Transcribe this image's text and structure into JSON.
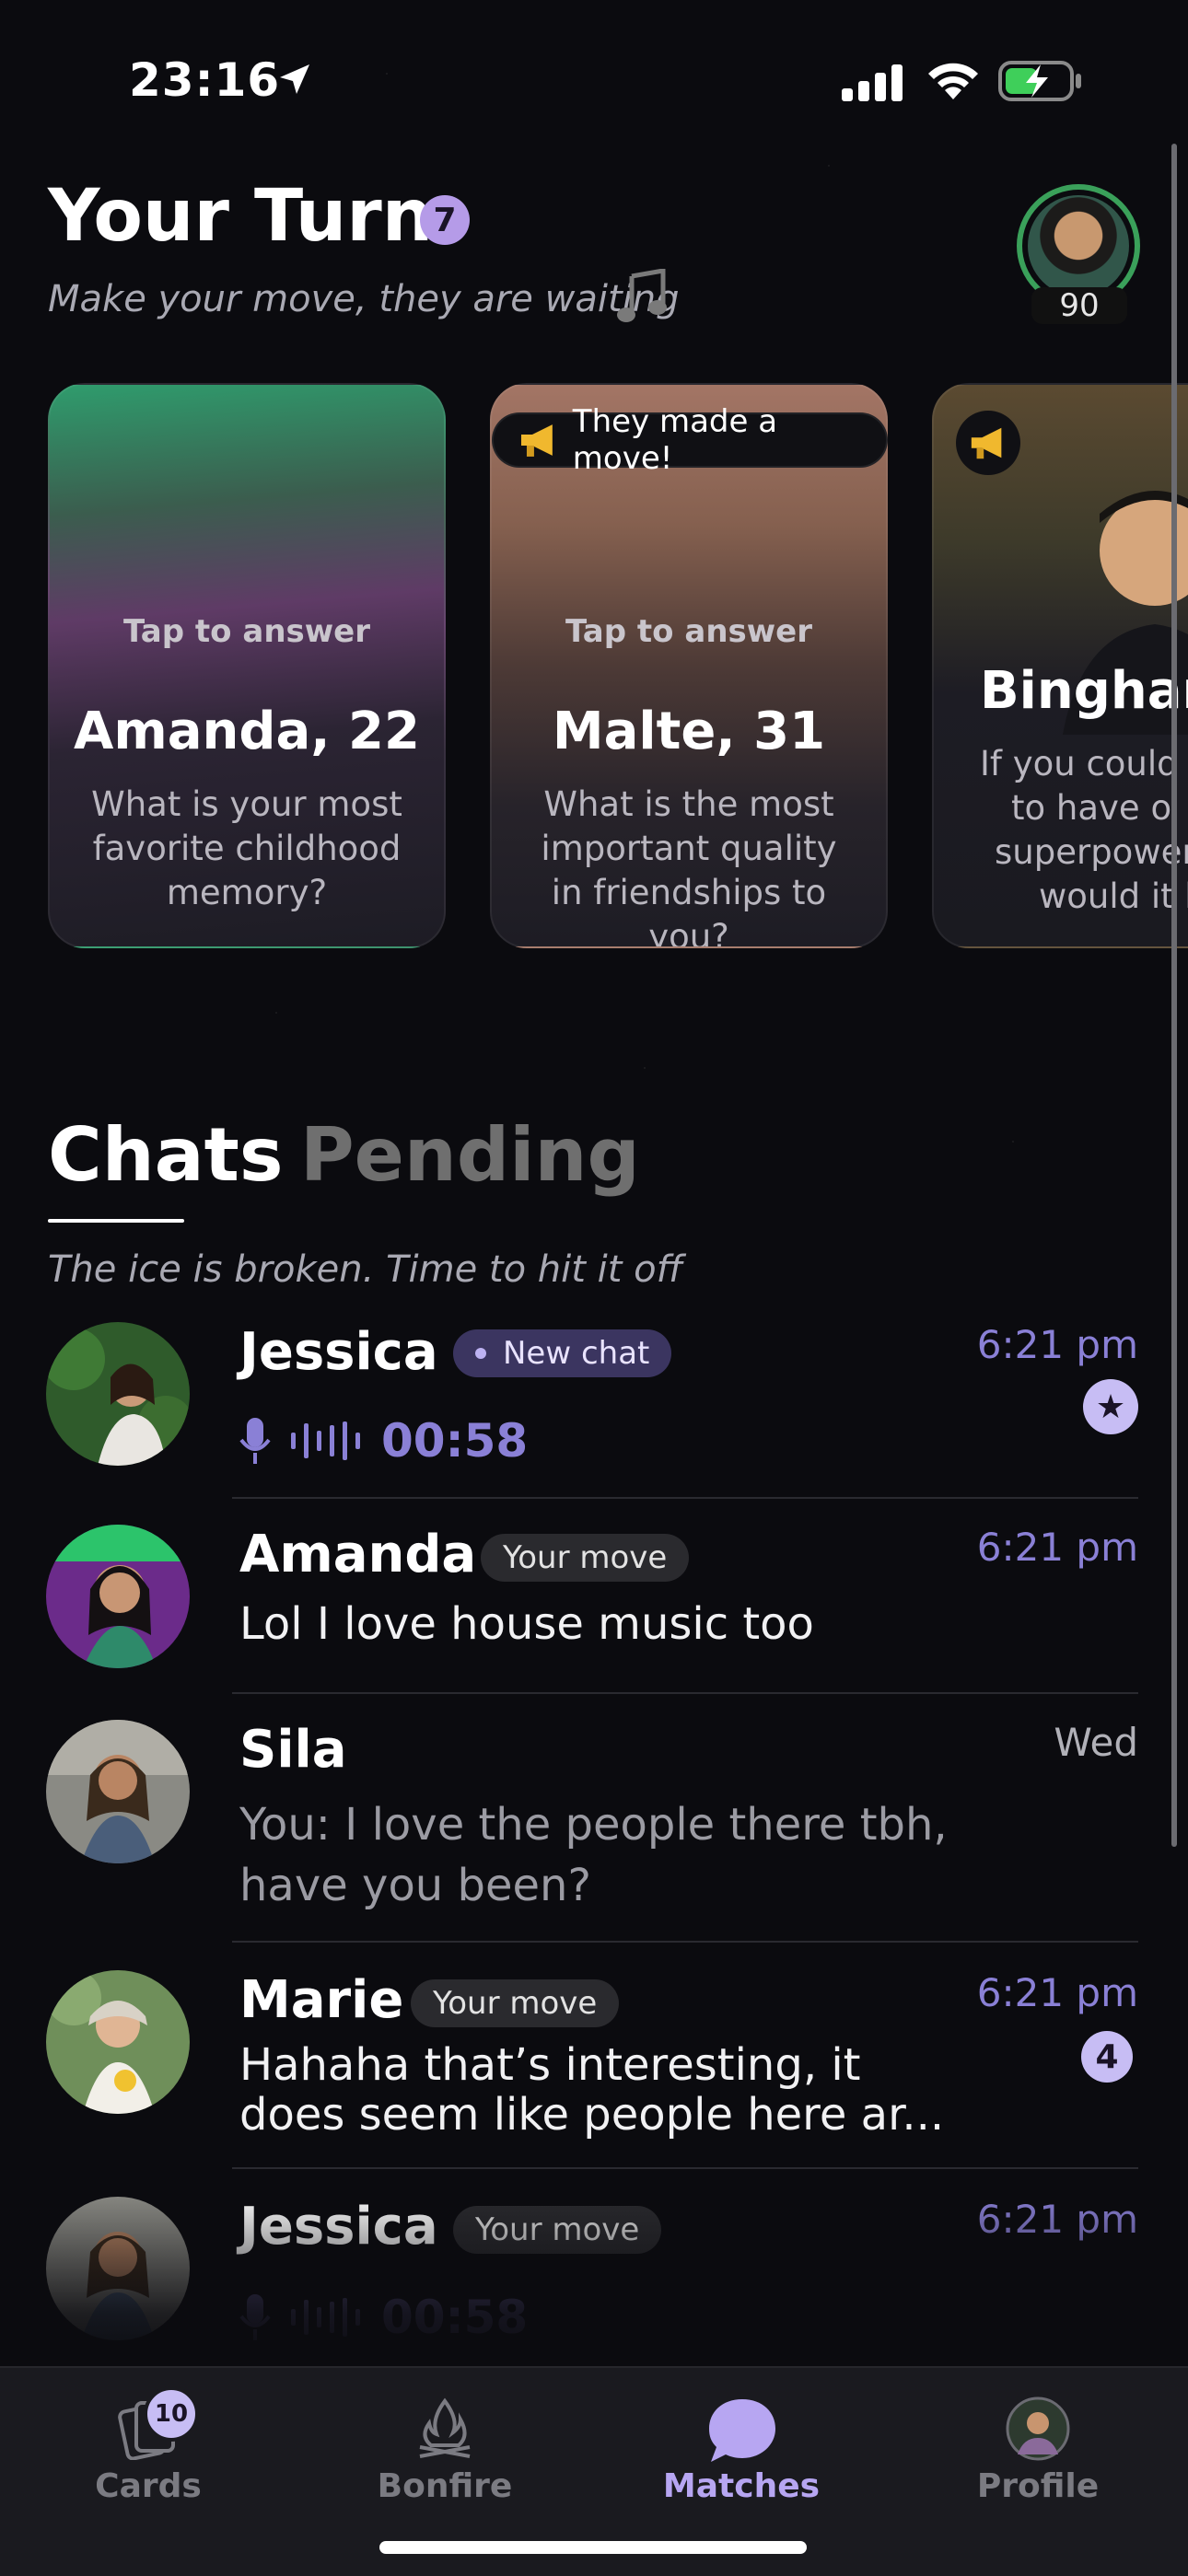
{
  "status_bar": {
    "time": "23:16"
  },
  "header": {
    "title": "Your Turn",
    "turn_count": "7",
    "subtitle": "Make your move, they are waiting",
    "profile_score": "90"
  },
  "cards": [
    {
      "tap_label": "Tap to answer",
      "name": "Amanda, 22",
      "question": "What is your most favorite childhood memory?"
    },
    {
      "tap_label": "Tap to answer",
      "name": "Malte, 31",
      "question": "What is the most important quality in friendships to you?",
      "badge": "They made a move!"
    },
    {
      "name": "Binghan",
      "question_lines": [
        "If you could c",
        "to have o",
        "superpower,",
        "would it b"
      ]
    }
  ],
  "chats_section": {
    "tab_chats": "Chats",
    "tab_pending": "Pending",
    "subtitle": "The ice is broken. Time to hit it off"
  },
  "chats": [
    {
      "name": "Jessica",
      "pill": "New chat",
      "time": "6:21 pm",
      "voice_duration": "00:58"
    },
    {
      "name": "Amanda",
      "pill": "Your move",
      "time": "6:21 pm",
      "message": "Lol I love house music too"
    },
    {
      "name": "Sila",
      "time": "Wed",
      "message_lines": [
        "You: I love the people there tbh,",
        "have you been?"
      ]
    },
    {
      "name": "Marie",
      "pill": "Your move",
      "time": "6:21 pm",
      "unread": "4",
      "message_lines": [
        "Hahaha that’s interesting, it",
        "does seem like people here ar..."
      ]
    },
    {
      "name": "Jessica",
      "pill": "Your move",
      "time": "6:21 pm",
      "voice_duration": "00:58"
    }
  ],
  "tabbar": {
    "cards": {
      "label": "Cards",
      "badge": "10"
    },
    "bonfire": {
      "label": "Bonfire"
    },
    "matches": {
      "label": "Matches"
    },
    "profile": {
      "label": "Profile"
    }
  },
  "colors": {
    "accent": "#8a80d6",
    "badge": "#c7bdf4",
    "background": "#0b0b0f"
  }
}
